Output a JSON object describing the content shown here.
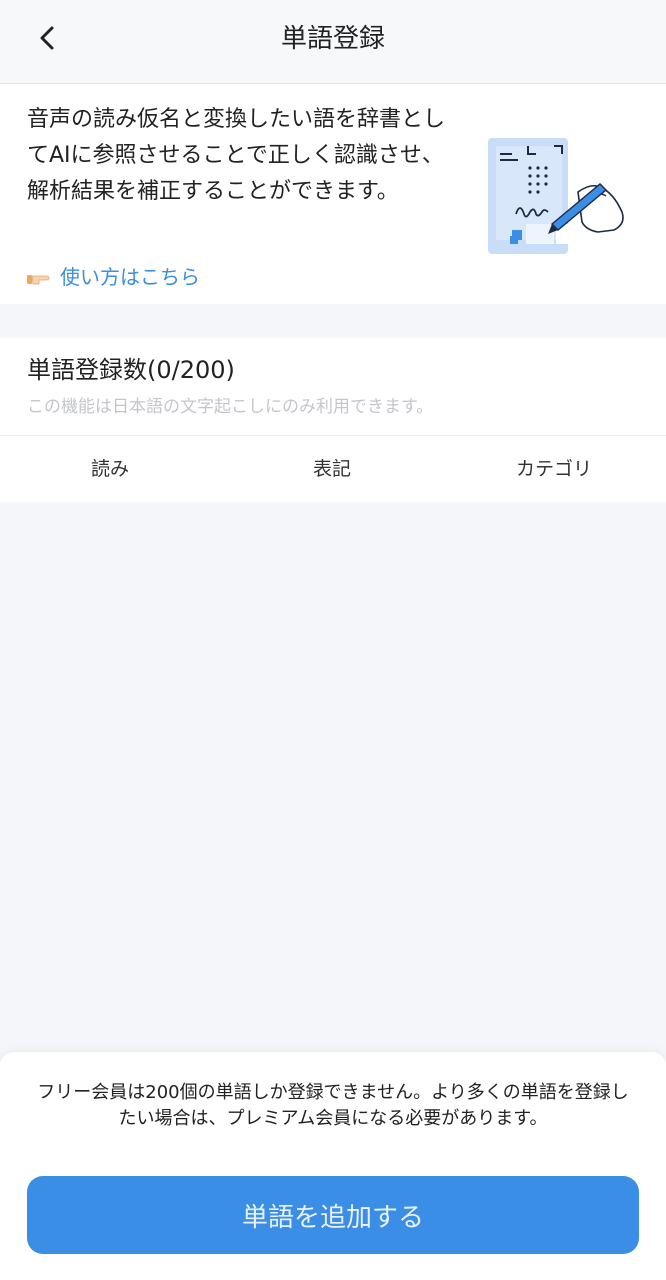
{
  "header": {
    "title": "単語登録",
    "back_icon": "chevron-left-icon"
  },
  "intro": {
    "text": "音声の読み仮名と変換したい語を辞書としてAIに参照させることで正しく認識させ、解析結果を補正することができます。",
    "link_label": "使い方はこちら",
    "link_icon": "pointing-hand-icon",
    "illustration_icon": "handwriting-document-illustration"
  },
  "word_count": {
    "title": "単語登録数(0/200)",
    "note": "この機能は日本語の文字起こしにのみ利用できます。"
  },
  "table": {
    "columns": [
      "読み",
      "表記",
      "カテゴリ"
    ],
    "rows": []
  },
  "footer": {
    "note": "フリー会員は200個の単語しか登録できません。より多くの単語を登録したい場合は、プレミアム会員になる必要があります。",
    "add_button_label": "単語を追加する"
  },
  "colors": {
    "accent": "#3a8ee6",
    "background": "#f5f6fa",
    "card": "#ffffff",
    "muted_text": "#c4c6cc"
  }
}
